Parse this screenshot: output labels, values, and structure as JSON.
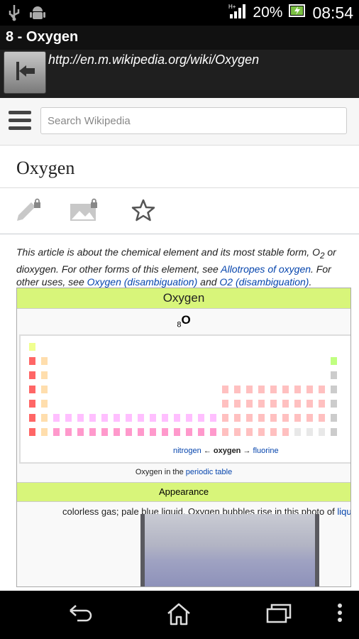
{
  "status_bar": {
    "battery": "20%",
    "time": "08:54",
    "icons": [
      "usb-icon",
      "android-icon",
      "signal-icon",
      "battery-icon"
    ]
  },
  "window": {
    "title": "8 - Oxygen"
  },
  "browser": {
    "url": "http://en.m.wikipedia.org/wiki/Oxygen"
  },
  "wiki_header": {
    "search_placeholder": "Search Wikipedia"
  },
  "page": {
    "title": "Oxygen",
    "hatnote": {
      "text1": "This article is about the chemical element and its most stable form, O",
      "sub": "2",
      "text2": " or dioxygen. For other forms of this element, see ",
      "link1": "Allotropes of oxygen",
      "text3": ". For other uses, see ",
      "link2": "Oxygen (disambiguation)",
      "text4": " and ",
      "link3": "O2 (disambiguation)",
      "text5": "."
    }
  },
  "infobox": {
    "title": "Oxygen",
    "atomic_number": "8",
    "symbol": "O",
    "nav_prev": "nitrogen",
    "nav_arrow_left": "←",
    "nav_current": "oxygen",
    "nav_arrow_right": "→",
    "nav_next": "fluorine",
    "caption_text": "Oxygen in the ",
    "caption_link": "periodic table",
    "section_appearance": "Appearance",
    "appearance_text": "colorless gas; pale blue liquid. Oxygen bubbles rise in this photo of ",
    "appearance_link": "liqu"
  },
  "colors": {
    "infobox_header": "#d8f57a",
    "link": "#0645ad",
    "alkali": "#ff6666",
    "alkaline_earth": "#ffdead",
    "lanthanide": "#ffbfff",
    "actinide": "#ff99cc",
    "nonmetal": "#f0ff8f"
  }
}
